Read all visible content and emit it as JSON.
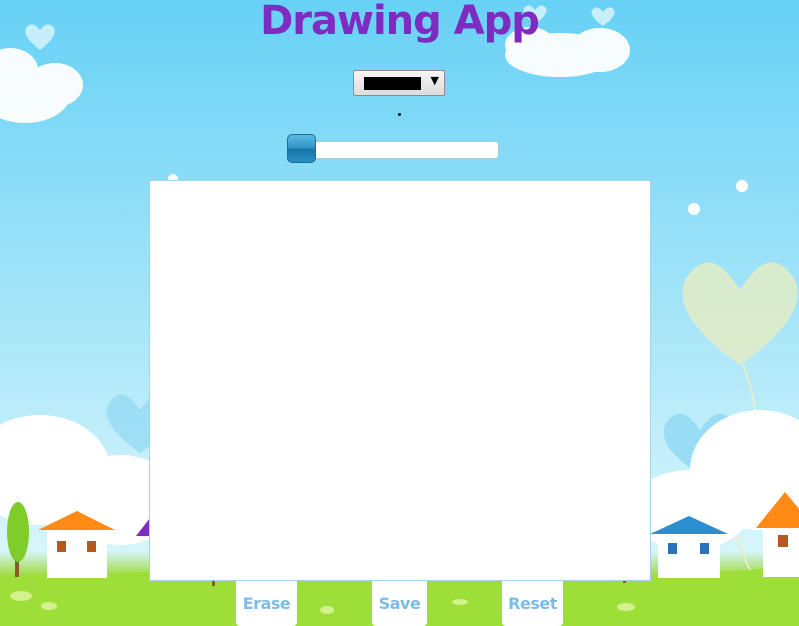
{
  "app": {
    "title": "Drawing App"
  },
  "toolbar": {
    "color_picker": {
      "selected_color": "#000000"
    },
    "brush_size": {
      "value": 0
    }
  },
  "buttons": {
    "erase": "Erase",
    "save": "Save",
    "reset": "Reset"
  },
  "colors": {
    "title": "#7d2bc0",
    "button_text": "#7cbce6",
    "slider": "#2f95c6"
  }
}
